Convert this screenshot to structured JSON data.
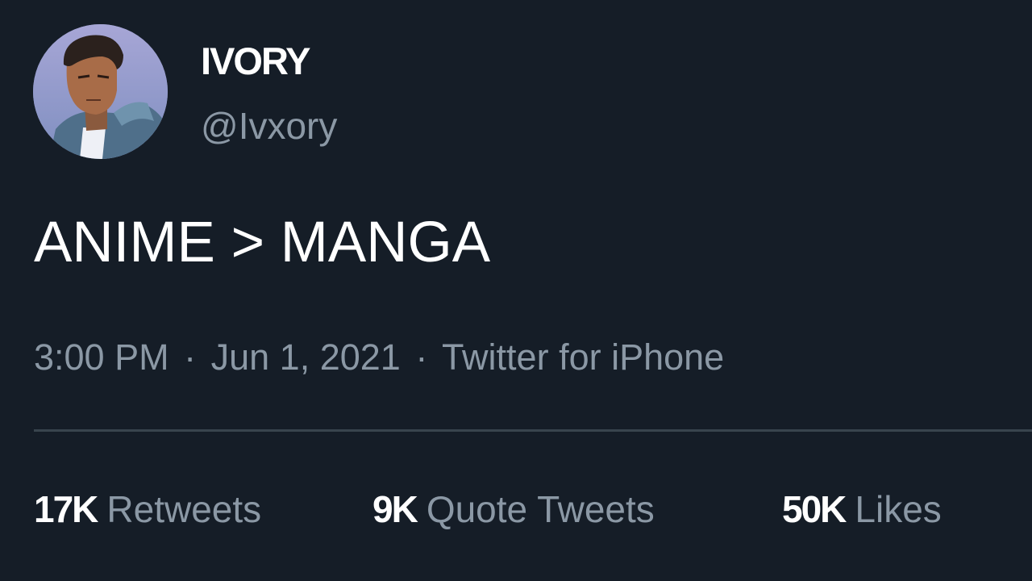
{
  "author": {
    "display_name": "IVORY",
    "handle": "@Ivxory",
    "avatar_icon": "profile-avatar"
  },
  "tweet": {
    "text": "ANIME > MANGA",
    "time": "3:00 PM",
    "separator": "·",
    "date": "Jun 1, 2021",
    "source": "Twitter for iPhone"
  },
  "stats": {
    "retweets": {
      "count": "17K",
      "label": "Retweets"
    },
    "quote_tweets": {
      "count": "9K",
      "label": "Quote Tweets"
    },
    "likes": {
      "count": "50K",
      "label": "Likes"
    }
  },
  "colors": {
    "background": "#151d27",
    "primary_text": "#ffffff",
    "secondary_text": "#8b98a5",
    "divider": "#38444d"
  }
}
